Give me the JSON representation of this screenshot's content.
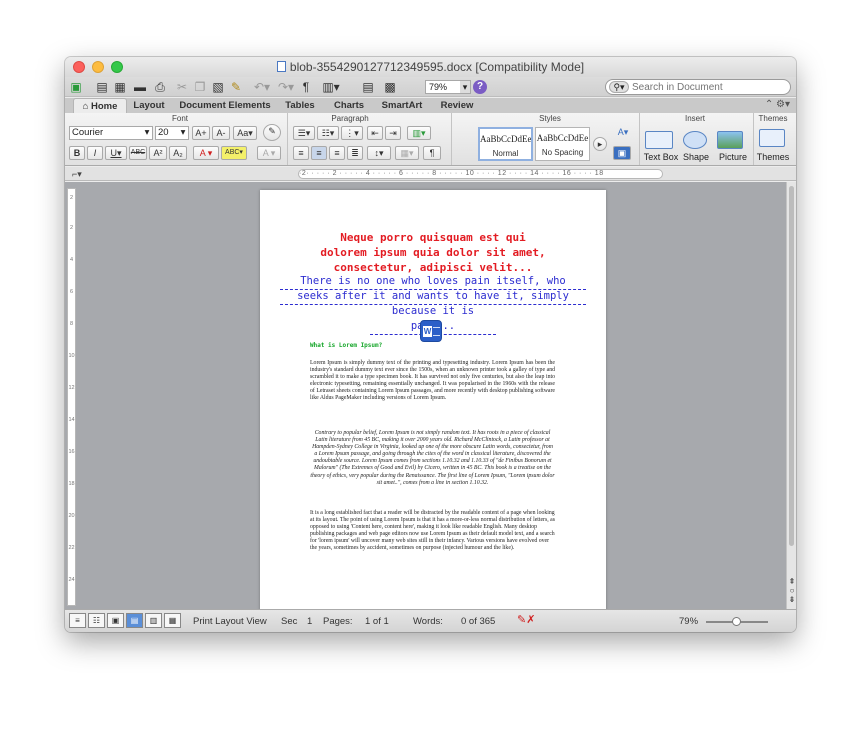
{
  "window": {
    "title": "blob-3554290127712349595.docx [Compatibility Mode]"
  },
  "quick_toolbar": {
    "zoom": "79%",
    "search_placeholder": "Search in Document"
  },
  "tabs": [
    "Home",
    "Layout",
    "Document Elements",
    "Tables",
    "Charts",
    "SmartArt",
    "Review"
  ],
  "ribbon": {
    "groups": {
      "font": "Font",
      "paragraph": "Paragraph",
      "styles": "Styles",
      "insert": "Insert",
      "themes": "Themes"
    },
    "font_name": "Courier",
    "font_size": "20",
    "styles": [
      {
        "preview": "AaBbCcDdEe",
        "name": "Normal"
      },
      {
        "preview": "AaBbCcDdEe",
        "name": "No Spacing"
      }
    ],
    "insert": {
      "text_box": "Text Box",
      "shape": "Shape",
      "picture": "Picture"
    },
    "themes_label": "Themes"
  },
  "ruler": {
    "ticks": "·2· · · · · 2 · · · · · 4 · · · · · 6 · · · · · 8 · · · · · 10 · · · · 12 · · · · 14 · · · · 16 · · · · 18"
  },
  "document": {
    "heading_red": [
      "Neque porro quisquam est qui",
      "dolorem ipsum quia dolor sit amet,",
      "consectetur, adipisci velit..."
    ],
    "heading_blue": [
      "There is no one who loves pain itself, who",
      "seeks after it and wants to have it, simply",
      "because it is pain..."
    ],
    "what_is": "What is Lorem Ipsum?",
    "para1": "Lorem Ipsum is simply dummy text of the printing and typesetting industry. Lorem Ipsum has been the industry's standard dummy text ever since the 1500s, when an unknown printer took a galley of type and scrambled it to make a type specimen book. It has survived not only five centuries, but also the leap into electronic typesetting, remaining essentially unchanged. It was popularised in the 1960s with the release of Letraset sheets containing Lorem Ipsum passages, and more recently with desktop publishing software like Aldus PageMaker including versions of Lorem Ipsum.",
    "para2": "Contrary to popular belief, Lorem Ipsum is not simply random text. It has roots in a piece of classical Latin literature from 45 BC, making it over 2000 years old. Richard McClintock, a Latin professor at Hampden-Sydney College in Virginia, looked up one of the more obscure Latin words, consectetur, from a Lorem Ipsum passage, and going through the cites of the word in classical literature, discovered the undoubtable source. Lorem Ipsum comes from sections 1.10.32 and 1.10.33 of \"de Finibus Bonorum et Malorum\" (The Extremes of Good and Evil) by Cicero, written in 45 BC. This book is a treatise on the theory of ethics, very popular during the Renaissance. The first line of Lorem Ipsum, \"Lorem ipsum dolor sit amet..\", comes from a line in section 1.10.32.",
    "para3": "It is a long established fact that a reader will be distracted by the readable content of a page when looking at its layout. The point of using Lorem Ipsum is that it has a more-or-less normal distribution of letters, as opposed to using 'Content here, content here', making it look like readable English. Many desktop publishing packages and web page editors now use Lorem Ipsum as their default model text, and a search for 'lorem ipsum' will uncover many web sites still in their infancy. Various versions have evolved over the years, sometimes by accident, sometimes on purpose (injected humour and the like)."
  },
  "statusbar": {
    "view": "Print Layout View",
    "sec_label": "Sec",
    "sec_value": "1",
    "pages_label": "Pages:",
    "pages_value": "1 of 1",
    "words_label": "Words:",
    "words_value": "0 of 365",
    "zoom": "79%"
  }
}
